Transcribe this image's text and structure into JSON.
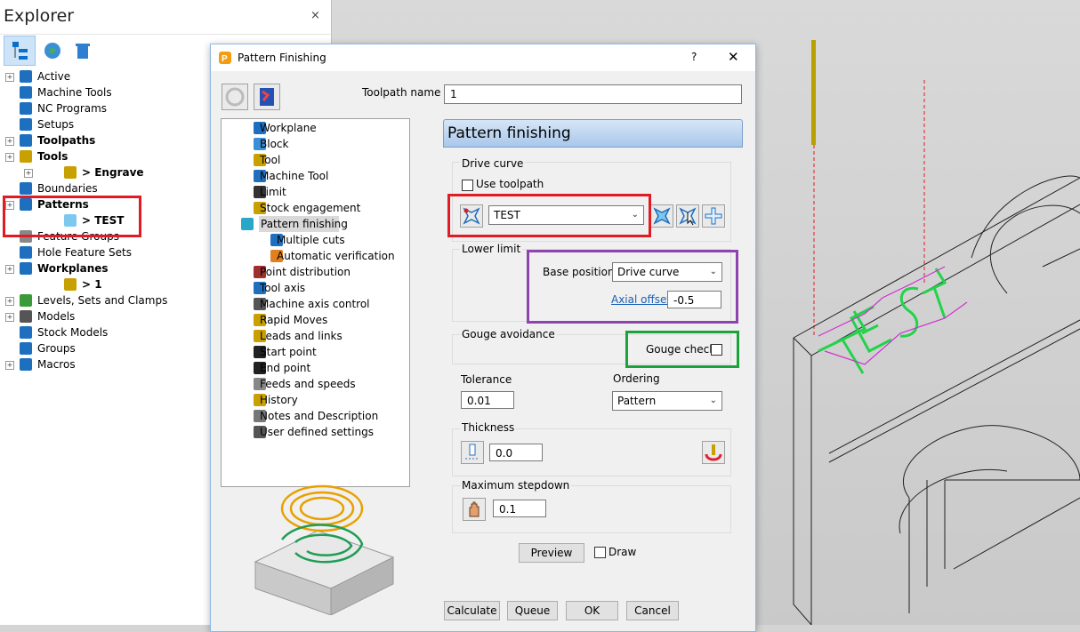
{
  "explorer": {
    "title": "Explorer",
    "close": "×",
    "tree": [
      {
        "label": "Active",
        "bold": false
      },
      {
        "label": "Machine Tools",
        "bold": false
      },
      {
        "label": "NC Programs",
        "bold": false
      },
      {
        "label": "Setups",
        "bold": false
      },
      {
        "label": "Toolpaths",
        "bold": true
      },
      {
        "label": "Tools",
        "bold": true
      },
      {
        "label": "> Engrave",
        "bold": true
      },
      {
        "label": "Boundaries",
        "bold": false
      },
      {
        "label": "Patterns",
        "bold": true
      },
      {
        "label": "> TEST",
        "bold": true
      },
      {
        "label": "Feature Groups",
        "bold": false
      },
      {
        "label": "Hole Feature Sets",
        "bold": false
      },
      {
        "label": "Workplanes",
        "bold": true
      },
      {
        "label": "> 1",
        "bold": true
      },
      {
        "label": "Levels, Sets and Clamps",
        "bold": false
      },
      {
        "label": "Models",
        "bold": false
      },
      {
        "label": "Stock Models",
        "bold": false
      },
      {
        "label": "Groups",
        "bold": false
      },
      {
        "label": "Macros",
        "bold": false
      }
    ]
  },
  "dialog": {
    "title": "Pattern Finishing",
    "help": "?",
    "close": "✕",
    "toolpath_name_label": "Toolpath name",
    "toolpath_name_value": "1",
    "page_tree": [
      "Workplane",
      "Block",
      "Tool",
      "Machine Tool",
      "Limit",
      "Stock engagement",
      "Pattern finishing",
      "Multiple cuts",
      "Automatic verification",
      "Point distribution",
      "Tool axis",
      "Machine axis control",
      "Rapid Moves",
      "Leads and links",
      "Start point",
      "End point",
      "Feeds and speeds",
      "History",
      "Notes and Description",
      "User defined settings"
    ],
    "panel_header": "Pattern finishing",
    "drive_curve": {
      "label": "Drive curve",
      "use_toolpath": "Use toolpath",
      "selected": "TEST"
    },
    "lower_limit": {
      "label": "Lower limit",
      "base_position_label": "Base position",
      "base_position_value": "Drive curve",
      "axial_offset_label": "Axial offset",
      "axial_offset_value": "-0.5"
    },
    "gouge": {
      "label": "Gouge avoidance",
      "check_label": "Gouge check"
    },
    "tolerance": {
      "label": "Tolerance",
      "value": "0.01"
    },
    "ordering": {
      "label": "Ordering",
      "value": "Pattern"
    },
    "thickness": {
      "label": "Thickness",
      "value": "0.0"
    },
    "stepdown": {
      "label": "Maximum stepdown",
      "value": "0.1"
    },
    "preview_button": "Preview",
    "draw_label": "Draw",
    "buttons": {
      "calculate": "Calculate",
      "queue": "Queue",
      "ok": "OK",
      "cancel": "Cancel"
    }
  },
  "colors": {
    "highlight_red": "#e01b24",
    "highlight_green": "#1aa33a",
    "highlight_purple": "#8e44ad",
    "pattern_green": "#22d34a",
    "pattern_magenta": "#d030d0",
    "header_blue": "#b9d2ee"
  }
}
